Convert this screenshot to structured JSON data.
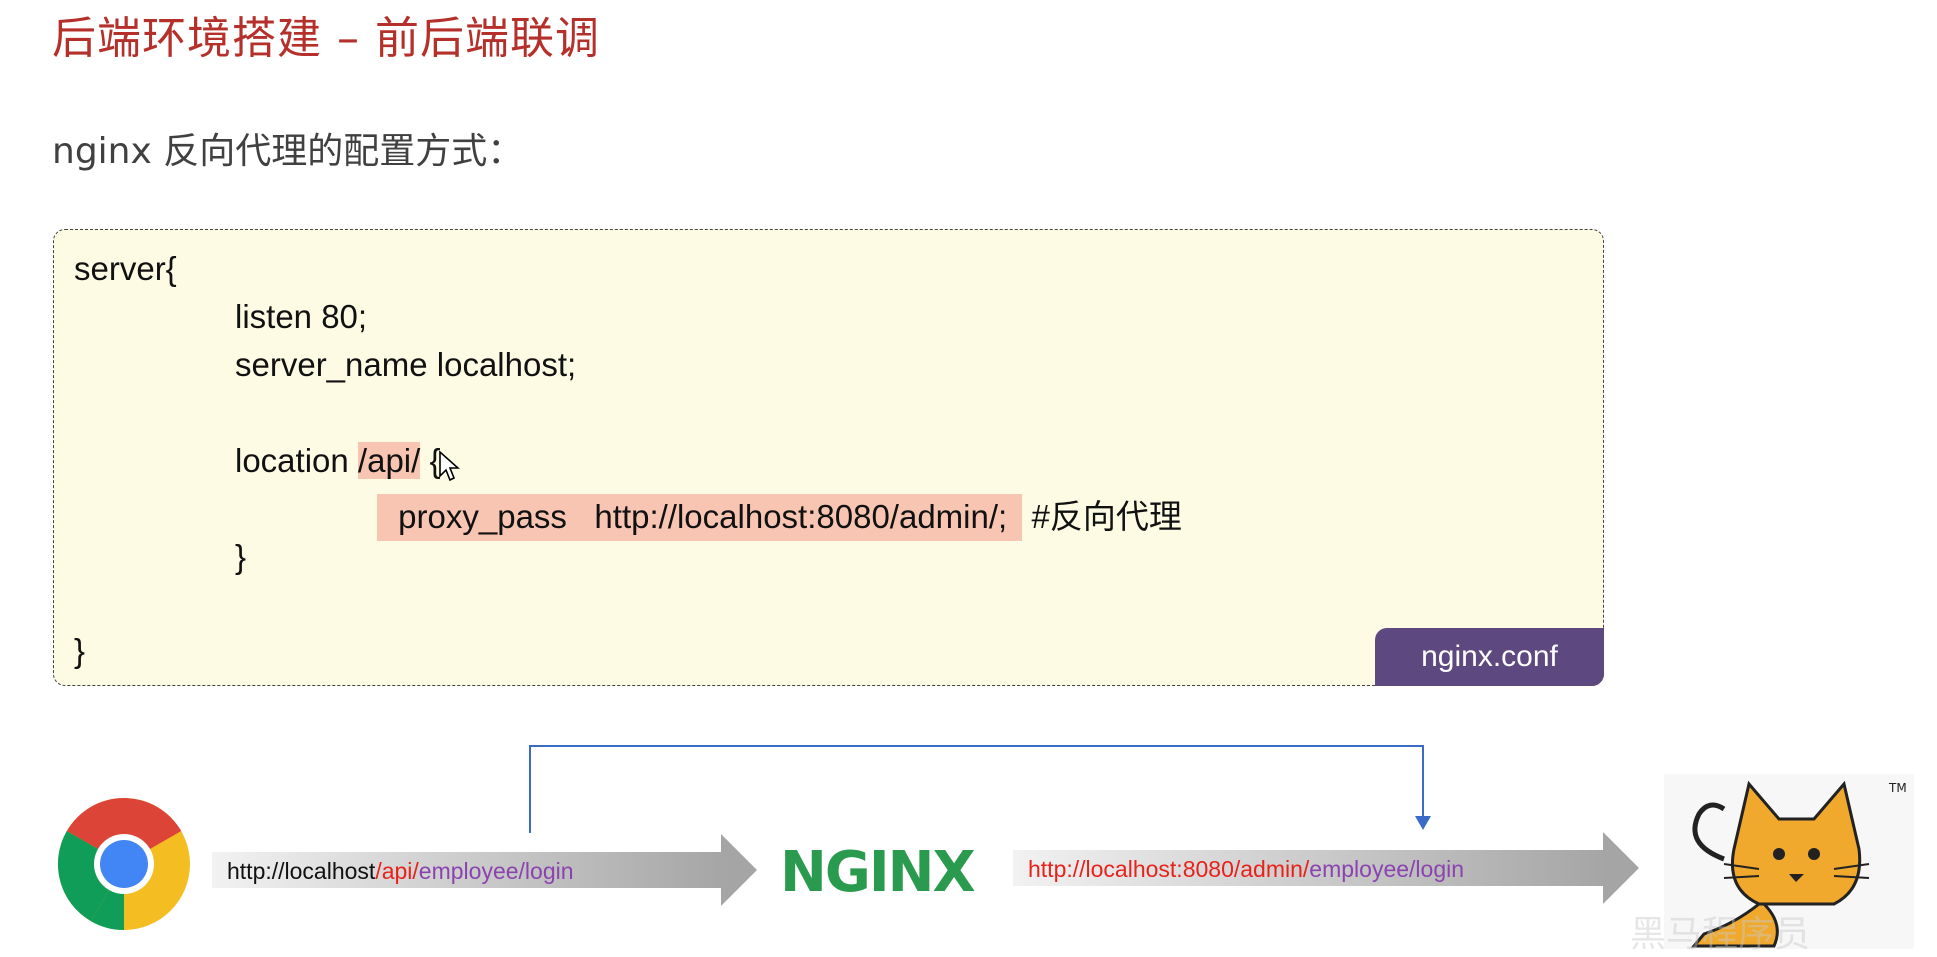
{
  "slide": {
    "title": "后端环境搭建 – 前后端联调",
    "subtitle": "nginx 反向代理的配置方式："
  },
  "config": {
    "filename": "nginx.conf",
    "line_server": "server{",
    "line_listen": "listen 80;",
    "line_server_name": "server_name localhost;",
    "line_location_keyword": "location ",
    "line_location_path": "/api/",
    "line_location_brace": " {",
    "line_proxy_pass": " proxy_pass   http://localhost:8080/admin/; ",
    "line_comment": " #反向代理",
    "line_inner_close": "}",
    "line_outer_close": "}"
  },
  "diagram": {
    "request_url": {
      "host": "http://localhost",
      "api": "/api/",
      "path": "employee/login"
    },
    "nginx_label": "NGINX",
    "proxied_url": {
      "host": "http://localhost:8080/admin/",
      "path": "employee/login"
    },
    "colors": {
      "host": "#111111",
      "highlight_red": "#e8221b",
      "path_purple": "#8b43b0",
      "nginx_green": "#2a9b4e",
      "bracket_blue": "#3a6cc7"
    },
    "icons": [
      "chrome-icon",
      "tomcat-logo-icon"
    ],
    "watermark": "黑马程序员"
  }
}
